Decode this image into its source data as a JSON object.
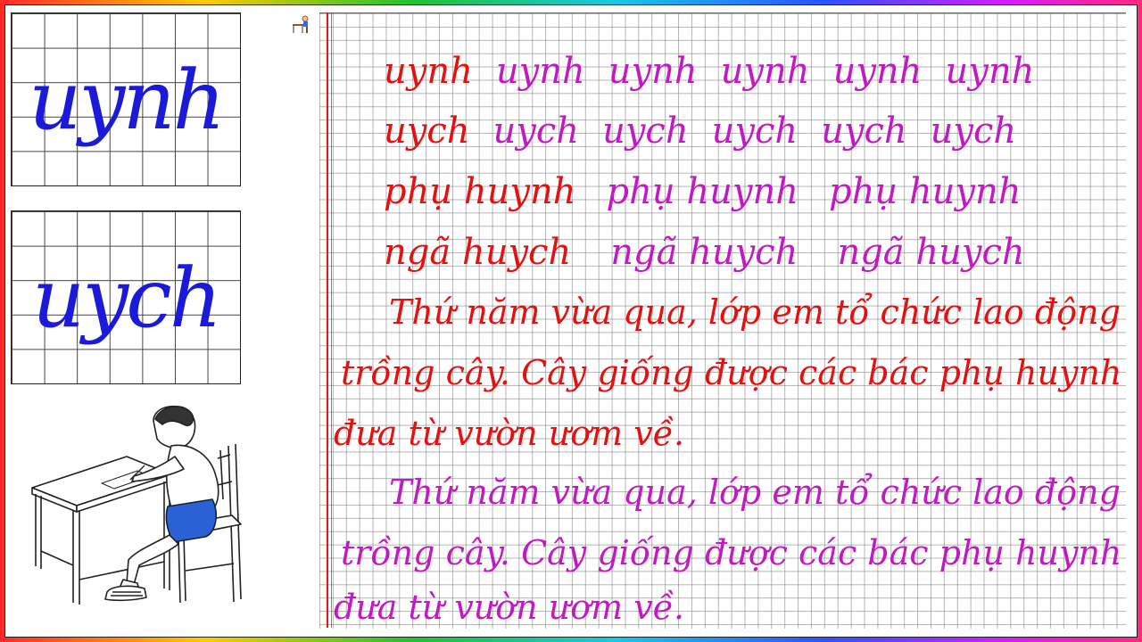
{
  "samples": {
    "first": "uynh",
    "second": "uych"
  },
  "practice": {
    "row1": [
      "uynh",
      "uynh",
      "uynh",
      "uynh",
      "uynh",
      "uynh"
    ],
    "row2": [
      "uych",
      "uych",
      "uych",
      "uych",
      "uych",
      "uych"
    ],
    "row3": [
      "phụ huynh",
      "phụ huynh",
      "phụ huynh"
    ],
    "row4": [
      "ngã huych",
      "ngã huych",
      "ngã huych"
    ]
  },
  "passage_red": {
    "line1": "Thứ năm vừa qua, lớp em tổ chức lao động",
    "line2": "trồng cây. Cây giống được các bác phụ huynh",
    "line3": "đưa từ vườn ươm về."
  },
  "passage_magenta": {
    "line1": "Thứ năm vừa qua, lớp em tổ chức lao động",
    "line2": "trồng cây. Cây giống được các bác phụ huynh",
    "line3": "đưa từ vườn ươm về."
  },
  "colors": {
    "ink_red": "#e51010",
    "ink_magenta": "#c21ac2",
    "sample_blue": "#1a1ad8"
  }
}
